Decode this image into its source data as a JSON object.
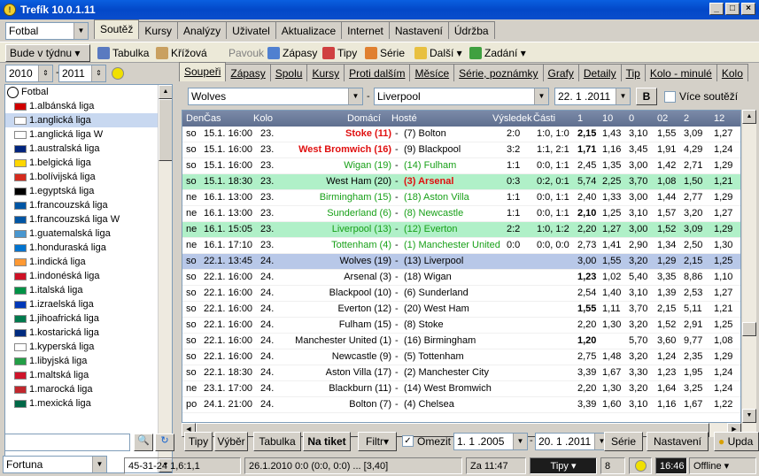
{
  "window": {
    "title": "Trefík 10.0.1.11"
  },
  "sport_select": "Fotbal",
  "main_tabs": [
    "Soutěž",
    "Kursy",
    "Analýzy",
    "Uživatel",
    "Aktualizace",
    "Internet",
    "Nastavení",
    "Údržba"
  ],
  "toolbar": {
    "period": "Bude v týdnu",
    "table": "Tabulka",
    "cross": "Křížová",
    "spider": "Pavouk",
    "matches": "Zápasy",
    "tips": "Tipy",
    "series": "Série",
    "more": "Další",
    "enter": "Zadání"
  },
  "years": {
    "from": "2010",
    "to": "2011"
  },
  "tree": {
    "root": "Fotbal",
    "items": [
      "1.albánská liga",
      "1.anglická liga",
      "1.anglická liga W",
      "1.australská liga",
      "1.belgická liga",
      "1.bolívijská liga",
      "1.egyptská liga",
      "1.francouzská liga",
      "1.francouzská liga W",
      "1.guatemalská liga",
      "1.honduraská liga",
      "1.indická liga",
      "1.indonéská liga",
      "1.italská liga",
      "1.izraelská liga",
      "1.jihoafrická liga",
      "1.kostarická liga",
      "1.kyperská liga",
      "1.libyjská liga",
      "1.maltská liga",
      "1.marocká liga",
      "1.mexická liga"
    ]
  },
  "sub_tabs": [
    "Soupeři",
    "Zápasy",
    "Spolu",
    "Kursy",
    "Proti dalším",
    "Měsíce",
    "Série, poznámky",
    "Grafy",
    "Detaily",
    "Tip",
    "Kolo - minulé",
    "Kolo"
  ],
  "filter": {
    "home": "Wolves",
    "away": "Liverpool",
    "date": "22. 1 .2011",
    "b": "B",
    "more": "Více soutěží"
  },
  "grid_headers": [
    "Den",
    "Čas",
    "Kolo",
    "Domácí",
    "Hosté",
    "Výsledek",
    "Části",
    "1",
    "10",
    "0",
    "02",
    "2",
    "12"
  ],
  "rows": [
    {
      "d": "so",
      "t": "15.1. 16:00",
      "k": "23.",
      "h": "Stoke (11)",
      "a": "(7) Bolton",
      "r": "2:0",
      "p": "1:0, 1:0",
      "o": [
        "2,15",
        "1,43",
        "3,10",
        "1,55",
        "3,09",
        "1,27"
      ],
      "hc": "red",
      "hb": true
    },
    {
      "d": "so",
      "t": "15.1. 16:00",
      "k": "23.",
      "h": "West Bromwich (16)",
      "a": "(9) Blackpool",
      "r": "3:2",
      "p": "1:1, 2:1",
      "o": [
        "1,71",
        "1,16",
        "3,45",
        "1,91",
        "4,29",
        "1,24"
      ],
      "hc": "red",
      "hb": true
    },
    {
      "d": "so",
      "t": "15.1. 16:00",
      "k": "23.",
      "h": "Wigan (19)",
      "a": "(14) Fulham",
      "r": "1:1",
      "p": "0:0, 1:1",
      "o": [
        "2,45",
        "1,35",
        "3,00",
        "1,42",
        "2,71",
        "1,29"
      ],
      "hc": "green",
      "ac": "green"
    },
    {
      "d": "so",
      "t": "15.1. 18:30",
      "k": "23.",
      "h": "West Ham (20)",
      "a": "(3) Arsenal",
      "r": "0:3",
      "p": "0:2, 0:1",
      "o": [
        "5,74",
        "2,25",
        "3,70",
        "1,08",
        "1,50",
        "1,21"
      ],
      "ac": "red",
      "ab": true,
      "hl": true
    },
    {
      "d": "ne",
      "t": "16.1. 13:00",
      "k": "23.",
      "h": "Birmingham (15)",
      "a": "(18) Aston Villa",
      "r": "1:1",
      "p": "0:0, 1:1",
      "o": [
        "2,40",
        "1,33",
        "3,00",
        "1,44",
        "2,77",
        "1,29"
      ],
      "hc": "green",
      "ac": "green"
    },
    {
      "d": "ne",
      "t": "16.1. 13:00",
      "k": "23.",
      "h": "Sunderland (6)",
      "a": "(8) Newcastle",
      "r": "1:1",
      "p": "0:0, 1:1",
      "o": [
        "2,10",
        "1,25",
        "3,10",
        "1,57",
        "3,20",
        "1,27"
      ],
      "hc": "green",
      "ac": "green"
    },
    {
      "d": "ne",
      "t": "16.1. 15:05",
      "k": "23.",
      "h": "Liverpool (13)",
      "a": "(12) Everton",
      "r": "2:2",
      "p": "1:0, 1:2",
      "o": [
        "2,20",
        "1,27",
        "3,00",
        "1,52",
        "3,09",
        "1,29"
      ],
      "hc": "green",
      "ac": "green",
      "hl": true
    },
    {
      "d": "ne",
      "t": "16.1. 17:10",
      "k": "23.",
      "h": "Tottenham (4)",
      "a": "(1) Manchester United",
      "r": "0:0",
      "p": "0:0, 0:0",
      "o": [
        "2,73",
        "1,41",
        "2,90",
        "1,34",
        "2,50",
        "1,30"
      ],
      "hc": "green",
      "ac": "green"
    },
    {
      "d": "so",
      "t": "22.1. 13:45",
      "k": "24.",
      "h": "Wolves (19)",
      "a": "(13) Liverpool",
      "r": "",
      "p": "",
      "o": [
        "3,00",
        "1,55",
        "3,20",
        "1,29",
        "2,15",
        "1,25"
      ],
      "sel": true
    },
    {
      "d": "so",
      "t": "22.1. 16:00",
      "k": "24.",
      "h": "Arsenal (3)",
      "a": "(18) Wigan",
      "r": "",
      "p": "",
      "o": [
        "1,23",
        "1,02",
        "5,40",
        "3,35",
        "8,86",
        "1,10"
      ]
    },
    {
      "d": "so",
      "t": "22.1. 16:00",
      "k": "24.",
      "h": "Blackpool (10)",
      "a": "(6) Sunderland",
      "r": "",
      "p": "",
      "o": [
        "2,54",
        "1,40",
        "3,10",
        "1,39",
        "2,53",
        "1,27"
      ]
    },
    {
      "d": "so",
      "t": "22.1. 16:00",
      "k": "24.",
      "h": "Everton (12)",
      "a": "(20) West Ham",
      "r": "",
      "p": "",
      "o": [
        "1,55",
        "1,11",
        "3,70",
        "2,15",
        "5,11",
        "1,21"
      ]
    },
    {
      "d": "so",
      "t": "22.1. 16:00",
      "k": "24.",
      "h": "Fulham (15)",
      "a": "(8) Stoke",
      "r": "",
      "p": "",
      "o": [
        "2,20",
        "1,30",
        "3,20",
        "1,52",
        "2,91",
        "1,25"
      ]
    },
    {
      "d": "so",
      "t": "22.1. 16:00",
      "k": "24.",
      "h": "Manchester United (1)",
      "a": "(16) Birmingham",
      "r": "",
      "p": "",
      "o": [
        "1,20",
        "",
        "5,70",
        "3,60",
        "9,77",
        "1,08"
      ]
    },
    {
      "d": "so",
      "t": "22.1. 16:00",
      "k": "24.",
      "h": "Newcastle (9)",
      "a": "(5) Tottenham",
      "r": "",
      "p": "",
      "o": [
        "2,75",
        "1,48",
        "3,20",
        "1,24",
        "2,35",
        "1,29"
      ]
    },
    {
      "d": "so",
      "t": "22.1. 18:30",
      "k": "24.",
      "h": "Aston Villa (17)",
      "a": "(2) Manchester City",
      "r": "",
      "p": "",
      "o": [
        "3,39",
        "1,67",
        "3,30",
        "1,23",
        "1,95",
        "1,24"
      ]
    },
    {
      "d": "ne",
      "t": "23.1. 17:00",
      "k": "24.",
      "h": "Blackburn (11)",
      "a": "(14) West Bromwich",
      "r": "",
      "p": "",
      "o": [
        "2,20",
        "1,30",
        "3,20",
        "1,64",
        "3,25",
        "1,24"
      ]
    },
    {
      "d": "po",
      "t": "24.1. 21:00",
      "k": "24.",
      "h": "Bolton (7)",
      "a": "(4) Chelsea",
      "r": "",
      "p": "",
      "o": [
        "3,39",
        "1,60",
        "3,10",
        "1,16",
        "1,67",
        "1,22"
      ]
    }
  ],
  "bottom_tabs": {
    "tipy": "Tipy",
    "vyber": "Výběr",
    "tabulka": "Tabulka",
    "tiket": "Na tiket",
    "filtr": "Filtr",
    "omezit": "Omezit",
    "date_from": "1. 1 .2005",
    "date_to": "20. 1 .2011",
    "serie": "Série",
    "nastaveni": "Nastavení",
    "update": "Upda"
  },
  "status": {
    "bookmaker": "Fortuna",
    "stats": "45-31-24  1,6:1,1",
    "last": "26.1.2010 0:0 (0:0, 0:0) ... [3,40]",
    "time": "Za 11:47",
    "tipy": "Tipy",
    "count": "8",
    "clock": "16:46",
    "mode": "Offline"
  }
}
